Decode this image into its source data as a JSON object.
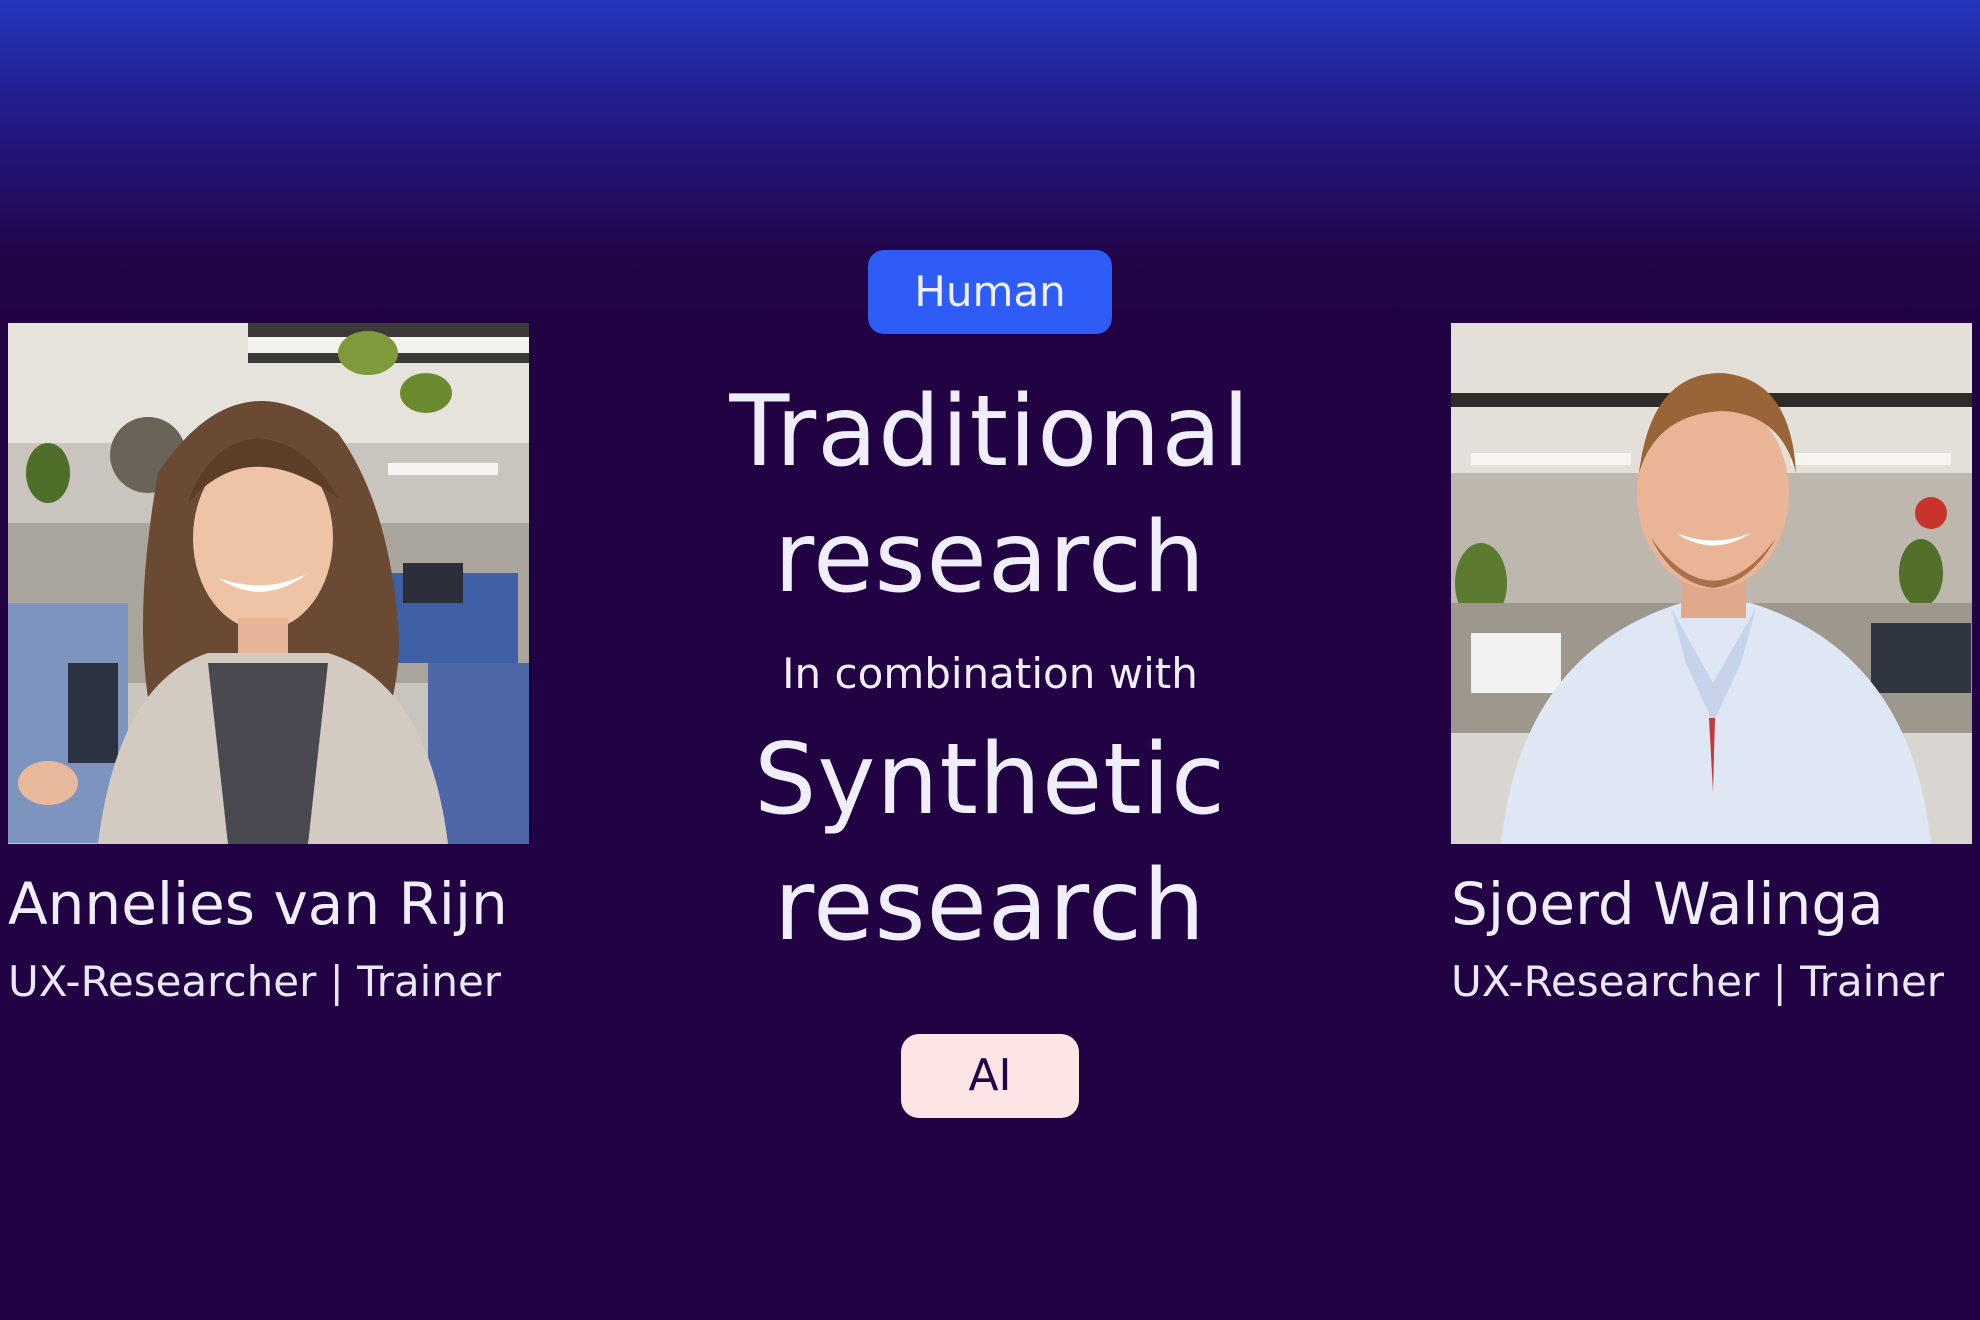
{
  "tags": {
    "human": "Human",
    "ai": "AI"
  },
  "headline": {
    "line1": "Traditional",
    "line2": "research",
    "connector": "In combination with",
    "line3": "Synthetic",
    "line4": "research"
  },
  "people": [
    {
      "name": "Annelies van Rijn",
      "role": "UX-Researcher | Trainer"
    },
    {
      "name": "Sjoerd Walinga",
      "role": "UX-Researcher | Trainer"
    }
  ],
  "colors": {
    "background": "#210343",
    "gradient_top": "#2338bd",
    "human_pill": "#2f5cf6",
    "ai_pill": "#fde5e6",
    "text": "#f1eefc"
  }
}
